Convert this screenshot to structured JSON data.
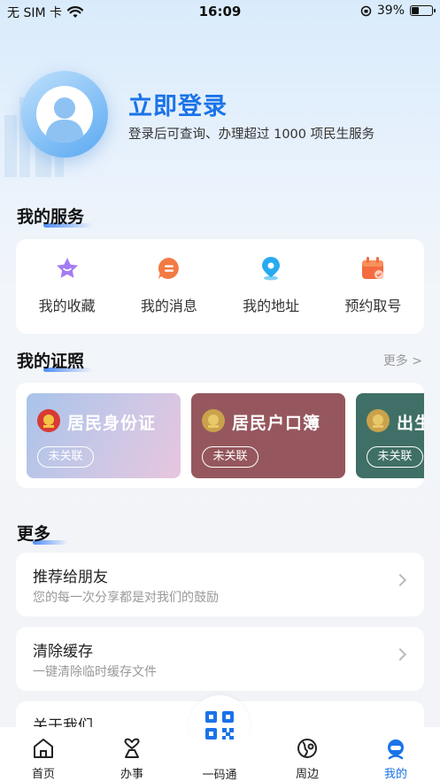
{
  "status_bar": {
    "carrier": "无 SIM 卡",
    "time": "16:09",
    "battery": "39%",
    "battery_level": 0.39
  },
  "profile": {
    "login_title": "立即登录",
    "login_subtitle": "登录后可查询、办理超过 1000 项民生服务"
  },
  "my_services": {
    "title": "我的服务",
    "items": [
      {
        "label": "我的收藏",
        "icon": "star-icon",
        "color": "#9b6cf2"
      },
      {
        "label": "我的消息",
        "icon": "message-icon",
        "color": "#f07a3e"
      },
      {
        "label": "我的地址",
        "icon": "location-icon",
        "color": "#22a8f0"
      },
      {
        "label": "预约取号",
        "icon": "calendar-icon",
        "color": "#f26a3e"
      }
    ]
  },
  "my_certificates": {
    "title": "我的证照",
    "more": "更多 >",
    "items": [
      {
        "title": "居民身份证",
        "status": "未关联",
        "color": "#c9c7e6"
      },
      {
        "title": "居民户口簿",
        "status": "未关联",
        "color": "#95575d"
      },
      {
        "title": "出生",
        "status": "未关联",
        "color": "#3f6f66"
      }
    ]
  },
  "more_section": {
    "title": "更多",
    "items": [
      {
        "title": "推荐给朋友",
        "subtitle": "您的每一次分享都是对我们的鼓励"
      },
      {
        "title": "清除缓存",
        "subtitle": "一键清除临时缓存文件"
      },
      {
        "title": "关于我们",
        "subtitle": ""
      }
    ]
  },
  "tabbar": {
    "tabs": [
      {
        "label": "首页",
        "icon": "home-icon"
      },
      {
        "label": "办事",
        "icon": "service-icon"
      },
      {
        "label": "一码通",
        "icon": "qr-code-icon"
      },
      {
        "label": "周边",
        "icon": "nearby-icon"
      },
      {
        "label": "我的",
        "icon": "profile-icon"
      }
    ],
    "active": "我的",
    "accent": "#1a73e8"
  }
}
